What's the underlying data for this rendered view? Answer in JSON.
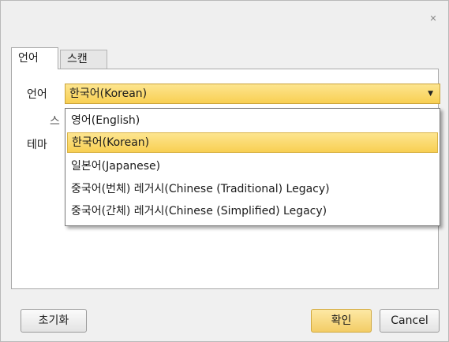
{
  "titlebar": {
    "close_glyph": "✕"
  },
  "tabs": [
    {
      "label": "언어",
      "active": true
    },
    {
      "label": "스캔",
      "active": false
    }
  ],
  "form": {
    "language_label": "언어",
    "theme_label": "테마",
    "partial_label": "스",
    "language_select": {
      "value": "한국어(Korean)"
    }
  },
  "dropdown": {
    "options": [
      "영어(English)",
      "한국어(Korean)",
      "일본어(Japanese)",
      "중국어(번체) 레거시(Chinese (Traditional) Legacy)",
      "중국어(간체) 레거시(Chinese (Simplified) Legacy)"
    ],
    "selected_index": 1
  },
  "buttons": {
    "reset": "초기화",
    "ok": "확인",
    "cancel": "Cancel"
  },
  "colors": {
    "highlight": "#f8cf52",
    "panel_bg": "#f0f0f0"
  }
}
